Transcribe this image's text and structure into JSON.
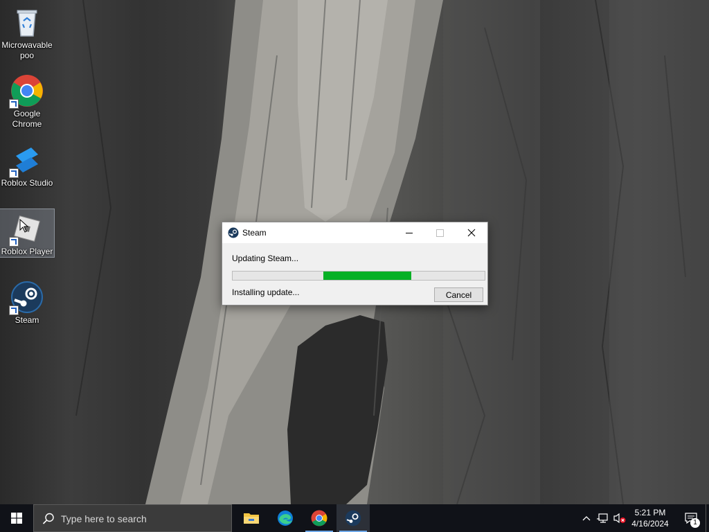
{
  "desktop": {
    "icons": [
      {
        "label": "Microwavable poo",
        "icon": "recycle-bin-icon"
      },
      {
        "label": "Google Chrome",
        "icon": "chrome-icon"
      },
      {
        "label": "Roblox Studio",
        "icon": "roblox-studio-icon"
      },
      {
        "label": "Roblox Player",
        "icon": "roblox-player-icon"
      },
      {
        "label": "Steam",
        "icon": "steam-icon"
      }
    ]
  },
  "dialog": {
    "title": "Steam",
    "status": "Updating Steam...",
    "substatus": "Installing update...",
    "cancel_label": "Cancel",
    "progress_start": 0.36,
    "progress_end": 0.71,
    "progress_color": "#06b025"
  },
  "taskbar": {
    "search_placeholder": "Type here to search",
    "apps": [
      {
        "name": "File Explorer",
        "icon": "folder-icon"
      },
      {
        "name": "Microsoft Edge",
        "icon": "edge-icon"
      },
      {
        "name": "Google Chrome",
        "icon": "chrome-icon"
      },
      {
        "name": "Steam",
        "icon": "steam-icon"
      }
    ],
    "time": "5:21 PM",
    "date": "4/16/2024",
    "notification_count": "1"
  }
}
